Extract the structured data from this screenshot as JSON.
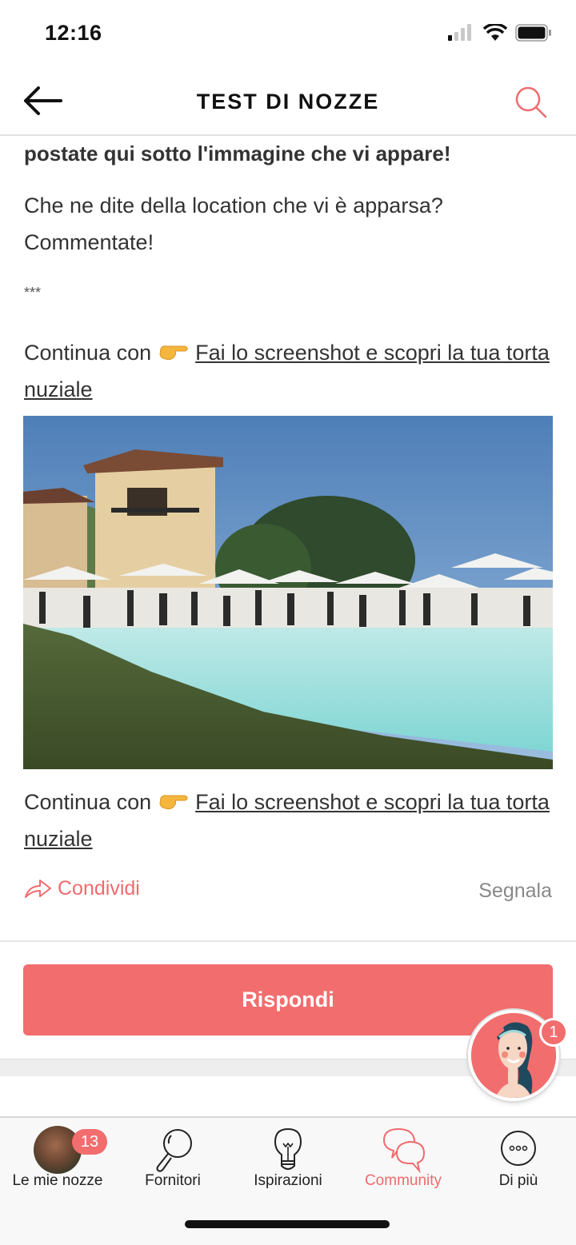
{
  "status_bar": {
    "time": "12:16",
    "icons": [
      "cellular-signal-icon",
      "wifi-icon",
      "battery-icon"
    ]
  },
  "nav": {
    "title": "TEST DI NOZZE",
    "back_icon": "arrow-left-icon",
    "search_icon": "search-icon"
  },
  "post": {
    "intro_bold": "postate qui sotto l'immagine che vi appare!",
    "question_line1": "Che ne dite della location che vi è apparsa?",
    "question_line2": "Commentate!",
    "separator": "***",
    "continue_prefix": "Continua con",
    "continue_emoji": "backhand-index-pointing-right-emoji",
    "continue_link": "Fai lo screenshot e scopri la tua torta nuziale",
    "image_alt": "Wedding reception by a pool with white umbrellas and a villa",
    "continue2_prefix": "Continua con",
    "continue2_link": "Fai lo screenshot e scopri la tua torta nuziale"
  },
  "actions": {
    "share_label": "Condividi",
    "report_label": "Segnala"
  },
  "reply_button": "Rispondi",
  "assistant": {
    "badge": "1"
  },
  "tab_bar": {
    "items": [
      {
        "label": "Le mie nozze",
        "icon": "avatar",
        "badge": "13",
        "active": false
      },
      {
        "label": "Fornitori",
        "icon": "magnifier-icon",
        "active": false
      },
      {
        "label": "Ispirazioni",
        "icon": "lightbulb-icon",
        "active": false
      },
      {
        "label": "Community",
        "icon": "chat-bubbles-icon",
        "active": true
      },
      {
        "label": "Di più",
        "icon": "more-dots-icon",
        "active": false
      }
    ]
  },
  "colors": {
    "accent": "#f26d6e",
    "text": "#333333",
    "muted": "#888888"
  }
}
